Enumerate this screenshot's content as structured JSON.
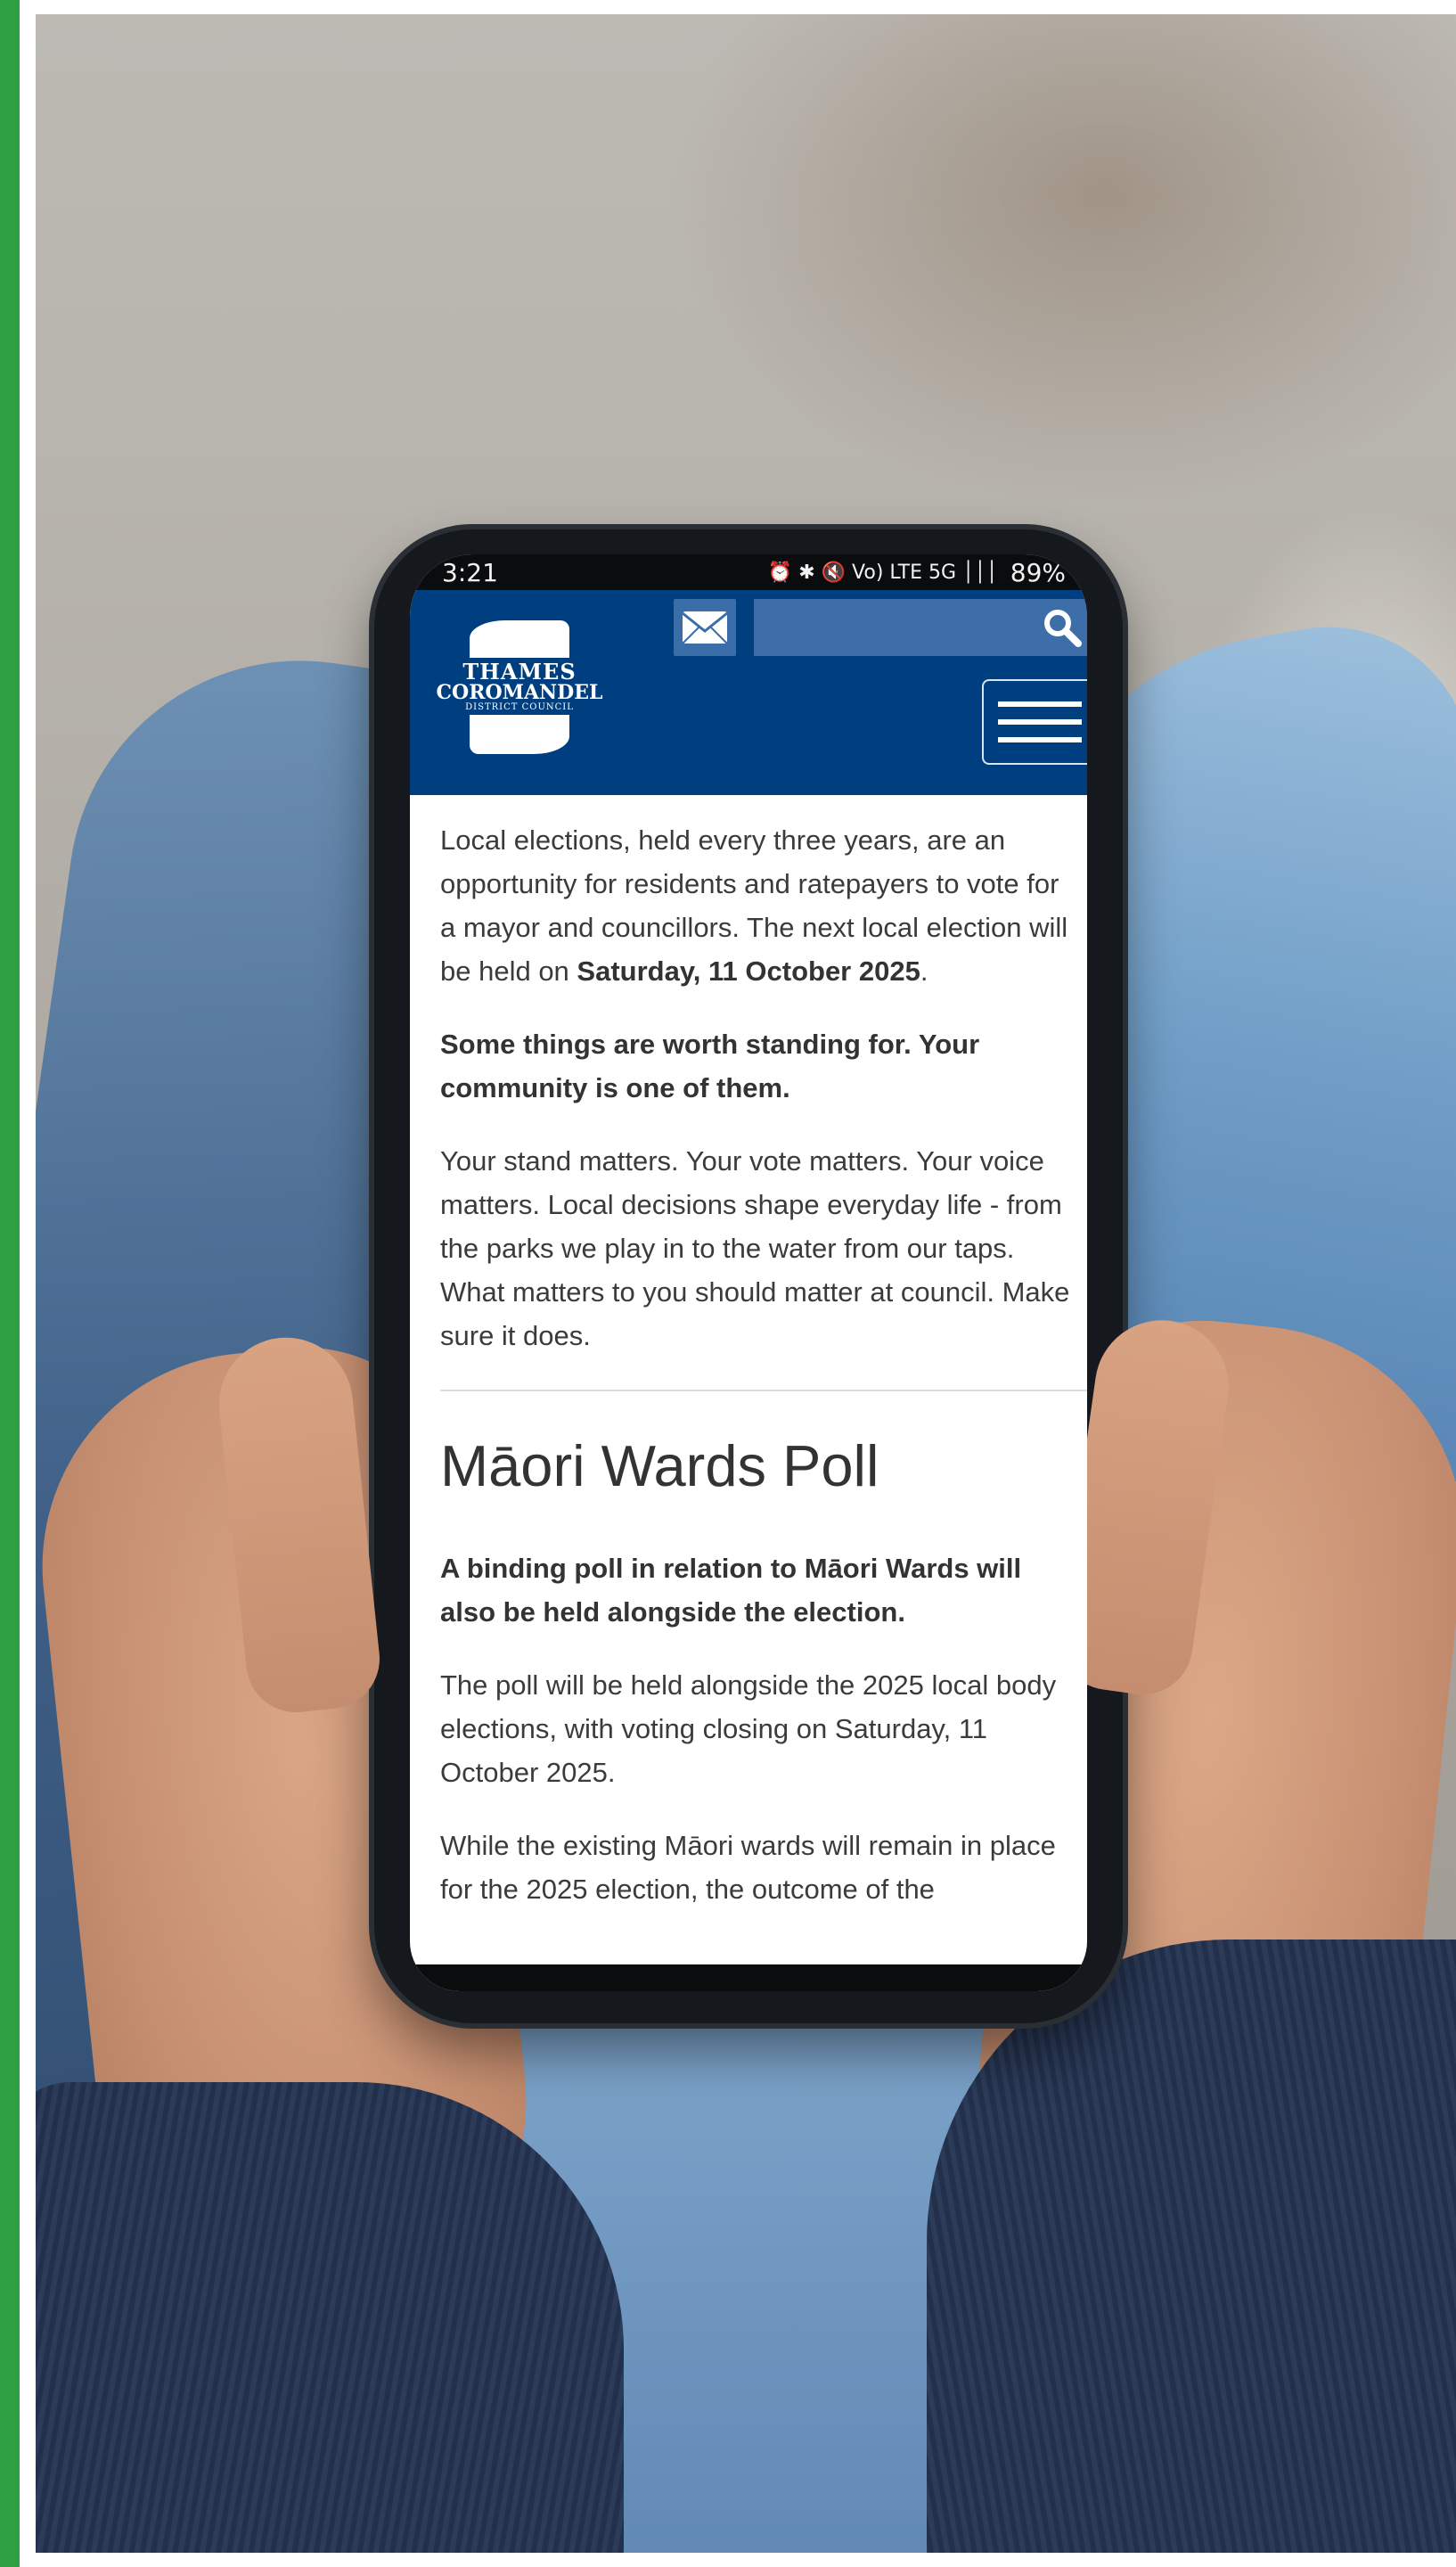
{
  "status_bar": {
    "time": "3:21",
    "icons_text": "⏰ ✱ 🔇 Vo) LTE 5G │││",
    "battery": "89%"
  },
  "header": {
    "logo": {
      "line1": "THAMES",
      "line2": "COROMANDEL",
      "line3": "DISTRICT COUNCIL"
    },
    "search": {
      "placeholder": "",
      "value": ""
    },
    "colors": {
      "header_bg": "#003f7f",
      "search_bg": "#3e6ea7"
    }
  },
  "content": {
    "p1_text": "Local elections, held every three years, are an opportunity for residents and ratepayers to vote for a mayor and councillors. The next local election will be held on ",
    "p1_bold": "Saturday, 11 October 2025",
    "p1_end": ".",
    "p2_bold": "Some things are worth standing for. Your community is one of them.",
    "p3": "Your stand matters. Your vote matters. Your voice matters. Local decisions shape everyday life - from the parks we play in to the water from our taps. What matters to you should matter at council. Make sure it does.",
    "heading": "Māori Wards Poll",
    "p4_bold": "A binding poll in relation to Māori Wards will also be held alongside the election.",
    "p5": "The poll will be held alongside the 2025 local body elections, with voting closing on Saturday, 11 October 2025.",
    "p6": "While the existing Māori wards will remain in place for the 2025 election, the outcome of the"
  }
}
